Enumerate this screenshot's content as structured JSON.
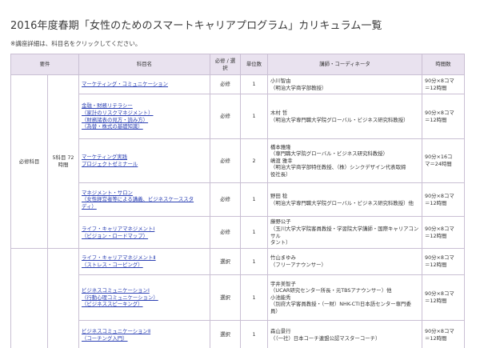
{
  "page": {
    "title": "2016年度春期「女性のためのスマートキャリアプログラム」カリキュラム一覧",
    "note": "※講座詳細は、科目名をクリックしてください。"
  },
  "table": {
    "headers": {
      "requirement": "要件",
      "subject": "科目名",
      "required_elective": "必修 / 選択",
      "credits": "単位数",
      "lecturer": "講師・コーディネータ",
      "hours": "時間数"
    },
    "groups": [
      {
        "label": "必修科目",
        "sub": "5科目 72時間"
      }
    ],
    "rows": [
      {
        "subject": [
          "マーケティング・コミュニケーション"
        ],
        "type": "必修",
        "credits": "1",
        "lecturer": [
          "小川智由",
          "（明治大学商学部教授）"
        ],
        "hours": [
          "90分×8コマ",
          "＝12時間"
        ]
      },
      {
        "subject": [
          "金融・財務リテラシー",
          "（家計のリスクマネジメント）",
          "（財務諸表の見方・読み方）",
          "（為替・株式の基礎知識）"
        ],
        "type": "必修",
        "credits": "1",
        "lecturer": [
          "木村 哲",
          "（明治大学専門職大学院グローバル・ビジネス研究科教授）"
        ],
        "hours": [
          "90分×8コマ",
          "＝12時間"
        ]
      },
      {
        "subject": [
          "マーケティング実践",
          "プロジェクトゼミナール"
        ],
        "type": "必修",
        "credits": "2",
        "lecturer": [
          "橋本雅隆",
          "（専門職大学院グローバル・ビジネス研究科教授）",
          "嶋渡 雅幸",
          "（明治大学商学部特任教授、（株）シンクデザイン代表取締",
          "役社長）"
        ],
        "hours": [
          "90分×16コ",
          "マ＝24時間"
        ]
      },
      {
        "subject": [
          "マネジメント・サロン",
          "（女性経営者等による講義、ビジネスケーススタ",
          "ディ）"
        ],
        "type": "必修",
        "credits": "1",
        "lecturer": [
          "野田 稔",
          "（明治大学専門職大学院グローバル・ビジネス研究科教授）他"
        ],
        "hours": [
          "90分×8コマ",
          "＝12時間"
        ]
      },
      {
        "subject": [
          "ライフ・キャリアマネジメントⅠ",
          "（ビジョン・ロードマップ）"
        ],
        "type": "必修",
        "credits": "1",
        "lecturer": [
          "藤野公子",
          "（玉川大学大学院客員教授・学習院大学講師・国際キャリアコンサル",
          "タント）"
        ],
        "hours": [
          "90分×8コマ",
          "＝12時間"
        ]
      },
      {
        "subject": [
          "ライフ・キャリアマネジメントⅡ",
          "（ストレス・コーピング）"
        ],
        "type": "選択",
        "credits": "1",
        "lecturer": [
          "竹山まゆみ",
          "（フリーアナウンサー）"
        ],
        "hours": [
          "90分×8コマ",
          "＝12時間"
        ]
      },
      {
        "subject": [
          "ビジネスコミュニケーションⅠ",
          "（行動心理コミュニケーション）",
          "（ビジネススピーキング）"
        ],
        "type": "選択",
        "credits": "1",
        "lecturer": [
          "宇井美智子",
          "（UCAR研究センター所長・元TBSアナウンサー）他",
          "小池能秀",
          "（別府大学客員教授・（一財）NHK-CTI日本語センター専門委",
          "員）"
        ],
        "hours": [
          "90分×8コマ",
          "＝12時間"
        ]
      },
      {
        "subject": [
          "ビジネスコミュニケーションⅡ",
          "（コーチング入門）"
        ],
        "type": "選択",
        "credits": "1",
        "lecturer": [
          "森山景行",
          "（（一社）日本コーチ連盟公認マスターコーチ）"
        ],
        "hours": [
          "90分×8コマ",
          "＝12時間"
        ]
      }
    ]
  }
}
